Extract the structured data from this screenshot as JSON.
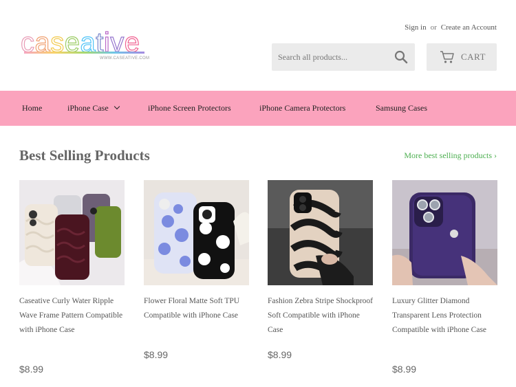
{
  "brand": {
    "name": "caseative",
    "tagline": "WWW.CASEATIVE.COM"
  },
  "header": {
    "sign_in": "Sign in",
    "or": "or",
    "create_account": "Create an Account",
    "search_placeholder": "Search all products...",
    "cart_label": "CART"
  },
  "nav": {
    "items": [
      {
        "label": "Home"
      },
      {
        "label": "iPhone Case"
      },
      {
        "label": "iPhone Screen Protectors"
      },
      {
        "label": "iPhone Camera Protectors"
      },
      {
        "label": "Samsung Cases"
      }
    ]
  },
  "section": {
    "title": "Best Selling Products",
    "more_link": "More best selling products ›"
  },
  "products": [
    {
      "title": "Caseative Curly Water Ripple Wave Frame Pattern Compatible with iPhone Case",
      "price": "$8.99"
    },
    {
      "title": "Flower Floral Matte Soft TPU Compatible with iPhone Case",
      "price": "$8.99"
    },
    {
      "title": "Fashion Zebra Stripe Shockproof Soft Compatible with iPhone Case",
      "price": "$8.99"
    },
    {
      "title": "Luxury Glitter Diamond Transparent Lens Protection Compatible with iPhone Case",
      "price": "$8.99"
    }
  ],
  "colors": {
    "nav_bg": "#fba3bd",
    "link_green": "#4caf50",
    "button_bg": "#ebebeb"
  },
  "icons": {
    "search": "search-icon",
    "cart": "cart-icon",
    "dropdown": "chevron-down-icon"
  }
}
